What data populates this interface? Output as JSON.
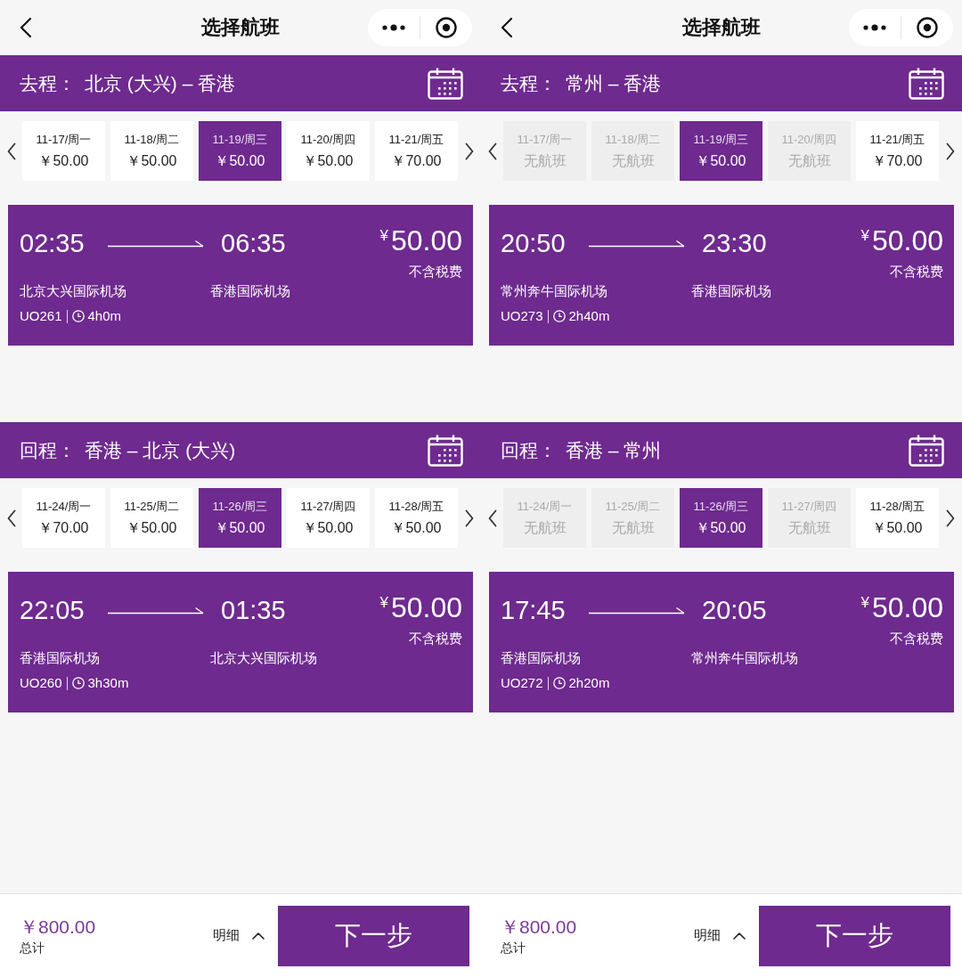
{
  "screens": [
    {
      "nav": {
        "title": "选择航班"
      },
      "legs": [
        {
          "label": "去程：",
          "route": "北京 (大兴) – 香港",
          "dates": [
            {
              "date": "11-17/周一",
              "price": "￥50.00",
              "available": true,
              "selected": false
            },
            {
              "date": "11-18/周二",
              "price": "￥50.00",
              "available": true,
              "selected": false
            },
            {
              "date": "11-19/周三",
              "price": "￥50.00",
              "available": true,
              "selected": true
            },
            {
              "date": "11-20/周四",
              "price": "￥50.00",
              "available": true,
              "selected": false
            },
            {
              "date": "11-21/周五",
              "price": "￥70.00",
              "available": true,
              "selected": false
            }
          ],
          "flight": {
            "depart_time": "02:35",
            "arrive_time": "06:35",
            "currency": "¥",
            "price": "50.00",
            "price_note": "不含税费",
            "depart_airport": "北京大兴国际机场",
            "arrive_airport": "香港国际机场",
            "flight_no": "UO261",
            "duration": "4h0m"
          }
        },
        {
          "label": "回程：",
          "route": "香港 – 北京 (大兴)",
          "dates": [
            {
              "date": "11-24/周一",
              "price": "￥70.00",
              "available": true,
              "selected": false
            },
            {
              "date": "11-25/周二",
              "price": "￥50.00",
              "available": true,
              "selected": false
            },
            {
              "date": "11-26/周三",
              "price": "￥50.00",
              "available": true,
              "selected": true
            },
            {
              "date": "11-27/周四",
              "price": "￥50.00",
              "available": true,
              "selected": false
            },
            {
              "date": "11-28/周五",
              "price": "￥50.00",
              "available": true,
              "selected": false
            }
          ],
          "flight": {
            "depart_time": "22:05",
            "arrive_time": "01:35",
            "currency": "¥",
            "price": "50.00",
            "price_note": "不含税费",
            "depart_airport": "香港国际机场",
            "arrive_airport": "北京大兴国际机场",
            "flight_no": "UO260",
            "duration": "3h30m"
          }
        }
      ],
      "footer": {
        "total": "￥800.00",
        "total_label": "总计",
        "details": "明细",
        "next": "下一步"
      }
    },
    {
      "nav": {
        "title": "选择航班"
      },
      "legs": [
        {
          "label": "去程：",
          "route": "常州 – 香港",
          "dates": [
            {
              "date": "11-17/周一",
              "price": "无航班",
              "available": false,
              "selected": false
            },
            {
              "date": "11-18/周二",
              "price": "无航班",
              "available": false,
              "selected": false
            },
            {
              "date": "11-19/周三",
              "price": "￥50.00",
              "available": true,
              "selected": true
            },
            {
              "date": "11-20/周四",
              "price": "无航班",
              "available": false,
              "selected": false
            },
            {
              "date": "11-21/周五",
              "price": "￥70.00",
              "available": true,
              "selected": false
            }
          ],
          "flight": {
            "depart_time": "20:50",
            "arrive_time": "23:30",
            "currency": "¥",
            "price": "50.00",
            "price_note": "不含税费",
            "depart_airport": "常州奔牛国际机场",
            "arrive_airport": "香港国际机场",
            "flight_no": "UO273",
            "duration": "2h40m"
          }
        },
        {
          "label": "回程：",
          "route": "香港 – 常州",
          "dates": [
            {
              "date": "11-24/周一",
              "price": "无航班",
              "available": false,
              "selected": false
            },
            {
              "date": "11-25/周二",
              "price": "无航班",
              "available": false,
              "selected": false
            },
            {
              "date": "11-26/周三",
              "price": "￥50.00",
              "available": true,
              "selected": true
            },
            {
              "date": "11-27/周四",
              "price": "无航班",
              "available": false,
              "selected": false
            },
            {
              "date": "11-28/周五",
              "price": "￥50.00",
              "available": true,
              "selected": false
            }
          ],
          "flight": {
            "depart_time": "17:45",
            "arrive_time": "20:05",
            "currency": "¥",
            "price": "50.00",
            "price_note": "不含税费",
            "depart_airport": "香港国际机场",
            "arrive_airport": "常州奔牛国际机场",
            "flight_no": "UO272",
            "duration": "2h20m"
          }
        }
      ],
      "footer": {
        "total": "￥800.00",
        "total_label": "总计",
        "details": "明细",
        "next": "下一步"
      }
    }
  ]
}
